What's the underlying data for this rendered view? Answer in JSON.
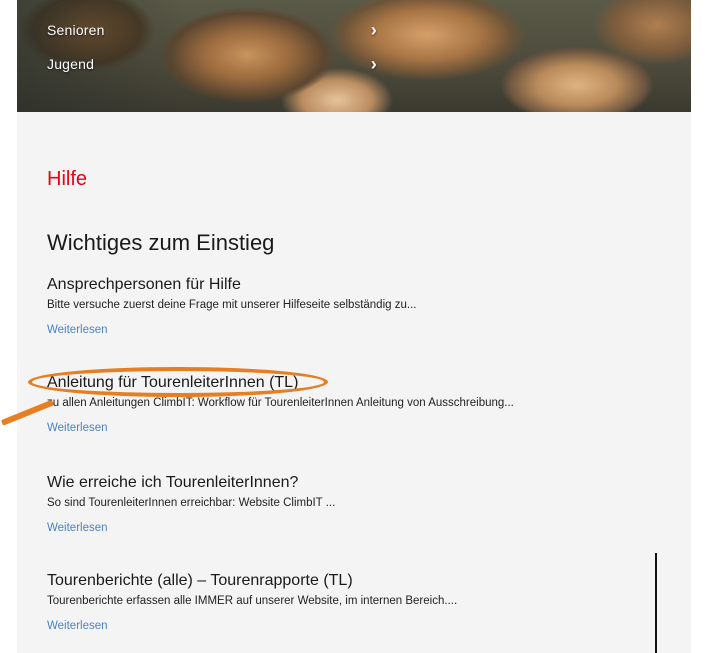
{
  "nav": {
    "items": [
      {
        "label": "Senioren"
      },
      {
        "label": "Jugend"
      }
    ]
  },
  "section_title": "Hilfe",
  "heading": "Wichtiges zum Einstieg",
  "articles": [
    {
      "title": "Ansprechpersonen für Hilfe",
      "excerpt": "Bitte versuche zuerst deine Frage mit unserer Hilfeseite selbständig zu...",
      "more": "Weiterlesen"
    },
    {
      "title": "Anleitung für TourenleiterInnen (TL)",
      "excerpt": "zu allen Anleitungen ClimbIT: Workflow für TourenleiterInnen Anleitung von Ausschreibung...",
      "more": "Weiterlesen"
    },
    {
      "title": "Wie erreiche ich TourenleiterInnen?",
      "excerpt": "So sind TourenleiterInnen erreichbar:    Website   ClimbIT  ...",
      "more": "Weiterlesen"
    },
    {
      "title": "Tourenberichte (alle) – Tourenrapporte (TL)",
      "excerpt": "Tourenberichte erfassen alle IMMER auf unserer Website, im internen Bereich....",
      "more": "Weiterlesen"
    }
  ],
  "colors": {
    "accent_red": "#e30613",
    "link_blue": "#4a83c6",
    "annotation_orange": "#e67e22"
  }
}
